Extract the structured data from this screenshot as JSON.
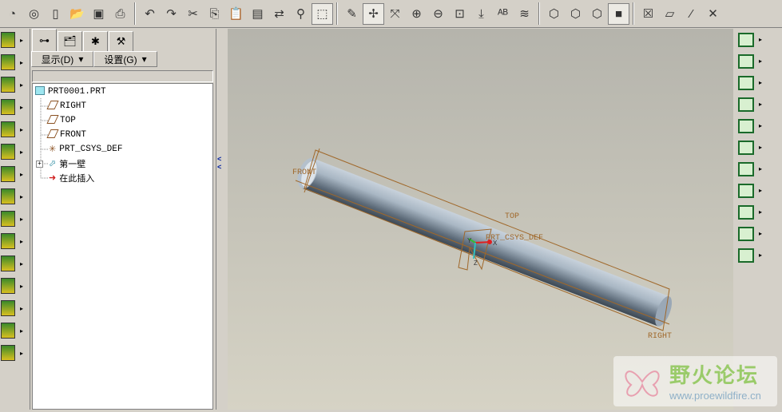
{
  "toolbar": {
    "groups": [
      [
        "session-icon",
        "cast-icon",
        "new-icon",
        "open-icon",
        "save-icon",
        "print-icon"
      ],
      [
        "undo-icon",
        "redo-icon",
        "cut-icon",
        "copy-icon",
        "paste-icon",
        "paste-special-icon",
        "regenerate-icon",
        "find-icon",
        "select-box-icon"
      ],
      [
        "repaint-icon",
        "spin-center-icon",
        "orient-icon",
        "zoom-in-icon",
        "zoom-out-icon",
        "refit-icon",
        "reorient-icon",
        "view-manager-icon",
        "layers-icon"
      ],
      [
        "wireframe-icon",
        "hidden-line-icon",
        "no-hidden-icon",
        "shaded-icon"
      ],
      [
        "close-window-icon",
        "datum-plane-display-icon",
        "datum-axis-display-icon",
        "csys-display-icon"
      ]
    ],
    "active": [
      "select-box-icon",
      "spin-center-icon",
      "shaded-icon"
    ]
  },
  "left_icons": [
    "new-feature-icon",
    "green-feature-icon",
    "bolt-icon",
    "tool-icon",
    "drill-icon",
    "pencil-icon",
    "yellow-pencil-icon",
    "frame-icon",
    "grid-icon",
    "db-icon",
    "green-feature2-icon",
    "flange-icon",
    "bend-icon",
    "edit-icon",
    "form-icon"
  ],
  "panel": {
    "tabs": [
      "model-tree-tab",
      "layers-tab",
      "favorites-tab",
      "tools-tab"
    ],
    "show_button": "显示(D)",
    "settings_button": "设置(G)",
    "tree": [
      {
        "label": "PRT0001.PRT",
        "icon": "part-icon"
      },
      {
        "label": "RIGHT",
        "icon": "datum-plane-icon"
      },
      {
        "label": "TOP",
        "icon": "datum-plane-icon"
      },
      {
        "label": "FRONT",
        "icon": "datum-plane-icon"
      },
      {
        "label": "PRT_CSYS_DEF",
        "icon": "csys-icon"
      },
      {
        "label": "第一壁",
        "icon": "sheetmetal-wall-icon"
      },
      {
        "label": "在此插入",
        "icon": "insert-here-arrow-icon"
      }
    ]
  },
  "viewport": {
    "labels": {
      "front": "FRONT",
      "top": "TOP",
      "right": "RIGHT",
      "csys": "PRT_CSYS_DEF",
      "x": "X",
      "y": "Y",
      "z": "Z"
    }
  },
  "right_icons": [
    "unbend-icon",
    "bend-back-icon",
    "flange-wall-icon",
    "flat-wall-icon",
    "twist-icon",
    "extend-icon",
    "rip-icon",
    "corner-relief-icon",
    "punch-icon",
    "form-icon2",
    "flat-pattern-icon"
  ],
  "watermark": {
    "title": "野火论坛",
    "url": "www.proewildfire.cn"
  }
}
